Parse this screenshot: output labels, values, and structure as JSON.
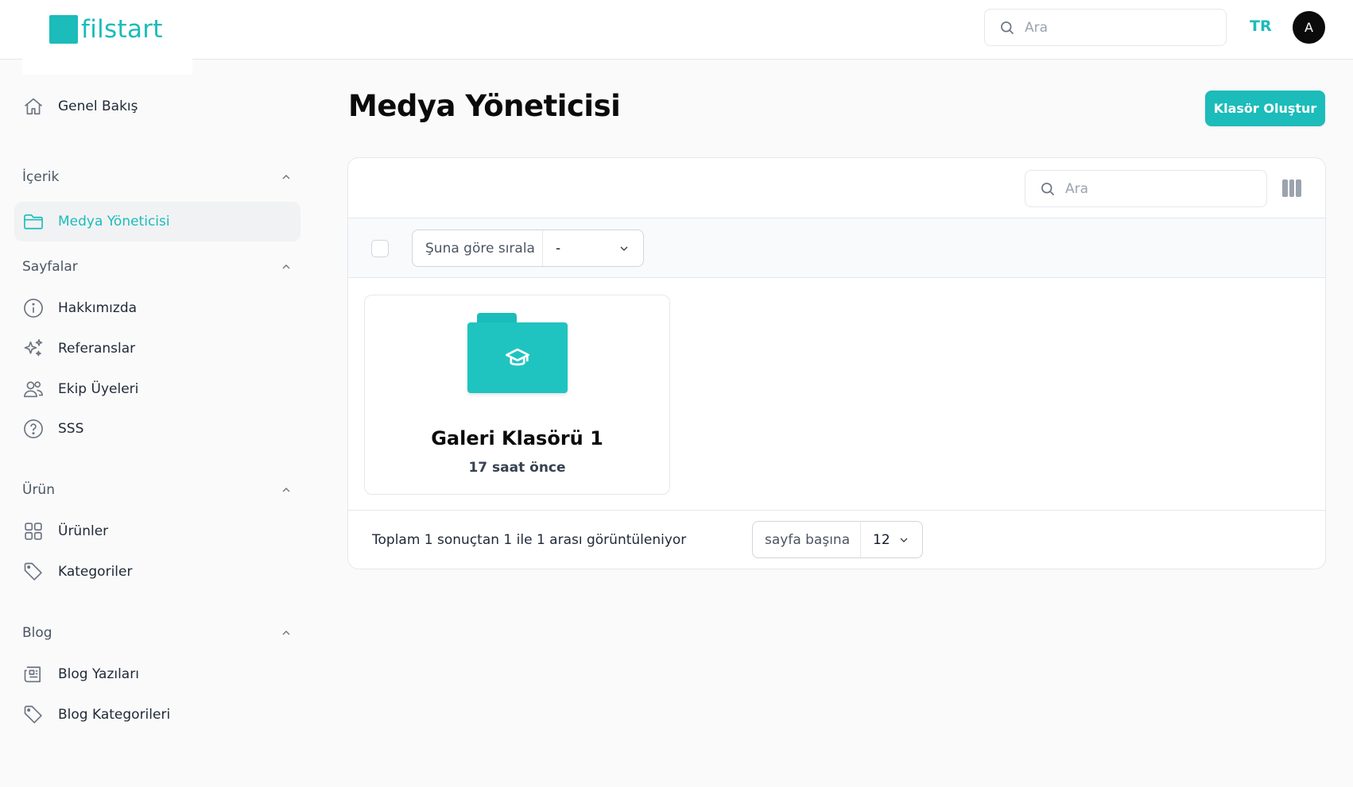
{
  "brand": {
    "name": "filstart",
    "accent": "#1bbcba"
  },
  "topbar": {
    "search_placeholder": "Ara",
    "language": "TR",
    "avatar_initial": "A"
  },
  "sidebar": {
    "overview": {
      "label": "Genel Bakış",
      "icon": "home-icon"
    },
    "groups": [
      {
        "label": "İçerik",
        "items": [
          {
            "label": "Medya Yöneticisi",
            "icon": "folder-icon",
            "active": true
          }
        ]
      },
      {
        "label": "Sayfalar",
        "items": [
          {
            "label": "Hakkımızda",
            "icon": "info-icon"
          },
          {
            "label": "Referanslar",
            "icon": "sparkles-icon"
          },
          {
            "label": "Ekip Üyeleri",
            "icon": "users-icon"
          },
          {
            "label": "SSS",
            "icon": "question-icon"
          }
        ]
      },
      {
        "label": "Ürün",
        "items": [
          {
            "label": "Ürünler",
            "icon": "grid-icon"
          },
          {
            "label": "Kategoriler",
            "icon": "tag-icon"
          }
        ]
      },
      {
        "label": "Blog",
        "items": [
          {
            "label": "Blog Yazıları",
            "icon": "newspaper-icon"
          },
          {
            "label": "Blog Kategorileri",
            "icon": "tag-icon"
          }
        ]
      }
    ]
  },
  "main": {
    "title": "Medya Yöneticisi",
    "create_button": "Klasör Oluştur",
    "table_search_placeholder": "Ara",
    "sort_label": "Şuna göre sırala",
    "sort_value": "-",
    "folders": [
      {
        "name": "Galeri Klasörü 1",
        "time": "17 saat önce",
        "icon": "graduation-cap-icon"
      }
    ],
    "footer": {
      "result_text": "Toplam 1 sonuçtan 1 ile 1 arası görüntüleniyor",
      "per_page_label": "sayfa başına",
      "per_page_value": "12"
    }
  }
}
